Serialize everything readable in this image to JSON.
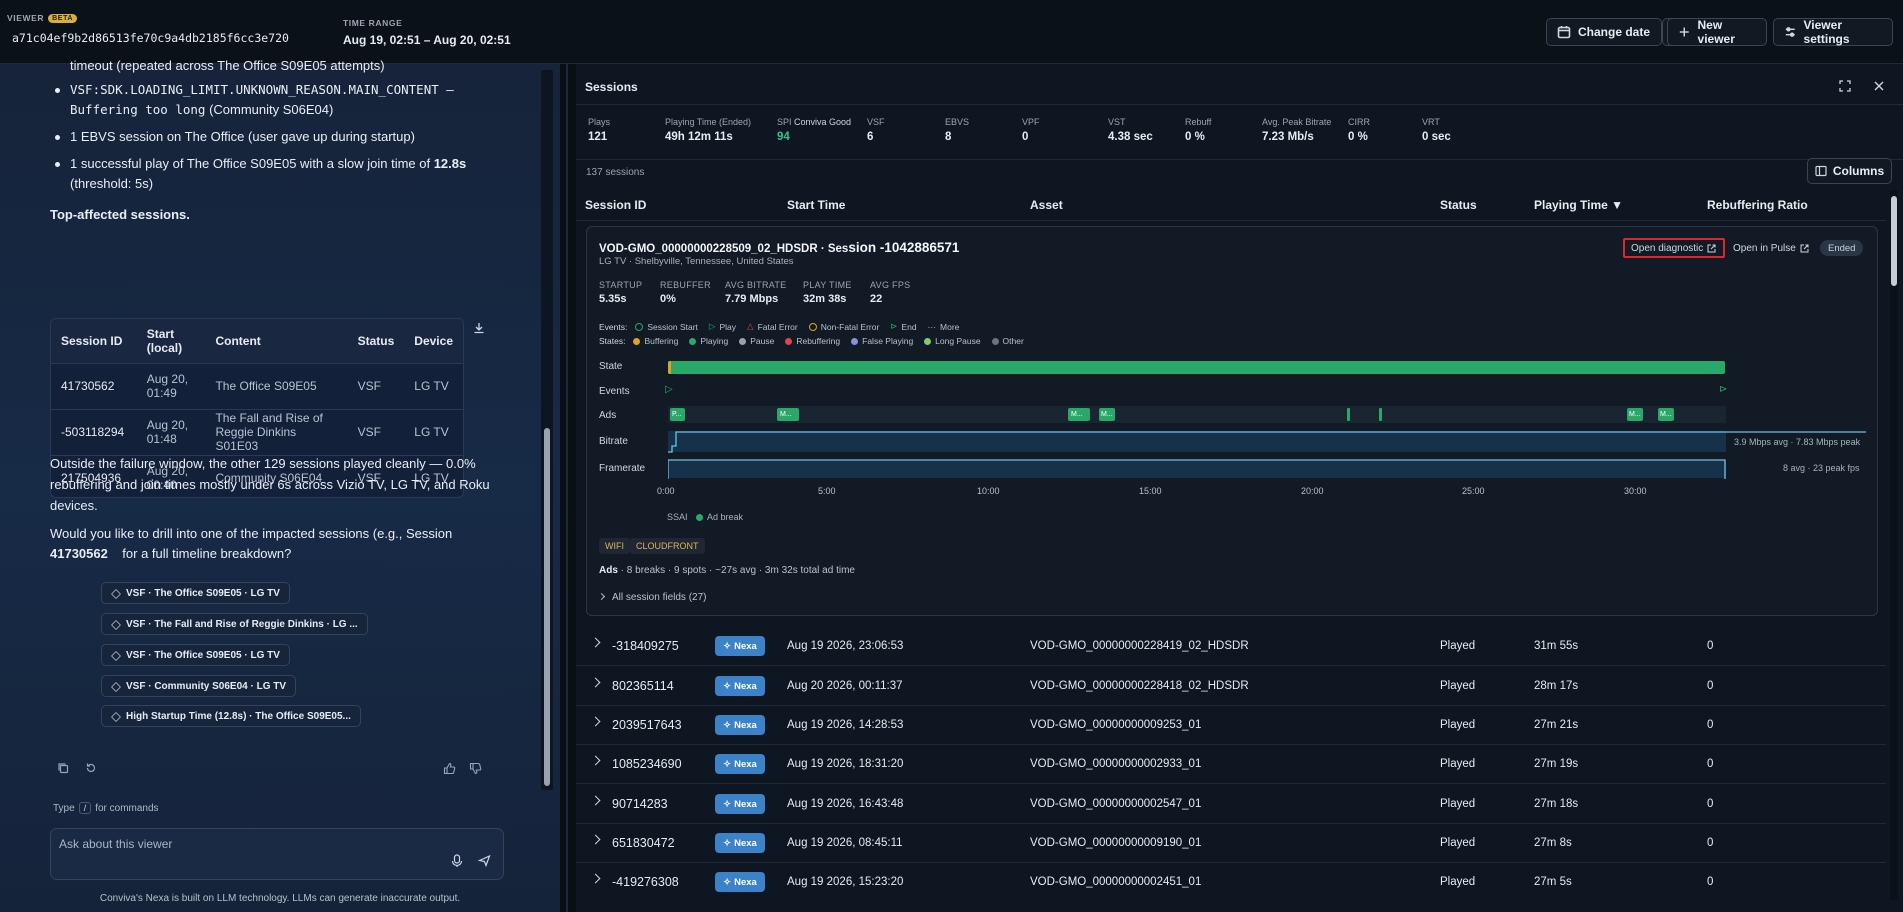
{
  "topbar": {
    "viewer_label": "VIEWER",
    "beta": "BETA",
    "viewer_id": "a71c04ef9b2d86513fe70c9a4db2185f6cc3e720",
    "time_range_label": "TIME RANGE",
    "time_range": "Aug 19, 02:51 – Aug 20, 02:51",
    "change_date": "Change date",
    "new_viewer": "New viewer",
    "viewer_settings": "Viewer settings"
  },
  "chat": {
    "line0": "timeout (repeated across The Office S09E05 attempts)",
    "b1_code": "VSF:SDK.LOADING_LIMIT.UNKNOWN_REASON.MAIN_CONTENT – Buffering too long",
    "b1_rest": " (Community S06E04)",
    "b2": "1 EBVS session on The Office (user gave up during startup)",
    "b3_pre": "1 successful play of The Office S09E05 with a slow join time of ",
    "b3_bold": "12.8s",
    "b3_post": "(threshold: 5s)",
    "heading": "Top-affected sessions.",
    "table_headers": [
      "Session ID",
      "Start (local)",
      "Content",
      "Status",
      "Device"
    ],
    "table_rows": [
      {
        "id": "41730562",
        "start": "Aug 20, 01:49",
        "content": "The Office S09E05",
        "status": "VSF",
        "device": "LG TV"
      },
      {
        "id": "-503118294",
        "start": "Aug 20, 01:48",
        "content": "The Fall and Rise of Reggie Dinkins S01E03",
        "status": "VSF",
        "device": "LG TV"
      },
      {
        "id": "217504936",
        "start": "Aug 20, 00:40",
        "content": "Community S06E04",
        "status": "VSF",
        "device": "LG TV"
      }
    ],
    "para1": "Outside the failure window, the other 129 sessions played cleanly — 0.0% rebuffering and join times mostly under 6s across Vizio TV, LG TV, and Roku devices.",
    "para2_pre": "Would you like to drill into one of the impacted sessions (e.g., Session",
    "para2_bold": "41730562",
    "para2_post": "for a full timeline breakdown?",
    "suggestions": [
      "VSF · The Office S09E05 · LG TV",
      "VSF · The Fall and Rise of Reggie Dinkins · LG ...",
      "VSF · The Office S09E05 · LG TV",
      "VSF · Community S06E04 · LG TV",
      "High Startup Time (12.8s) · The Office S09E05..."
    ],
    "cmd_pre": "Type",
    "cmd_key": "/",
    "cmd_post": "for commands",
    "input_placeholder": "Ask about this viewer",
    "disclaimer": "Conviva's Nexa is built on LLM technology. LLMs can generate inaccurate output."
  },
  "sessions": {
    "title": "Sessions",
    "metrics": [
      {
        "label": "Plays",
        "value": "121"
      },
      {
        "label": "Playing Time (Ended)",
        "value": "49h 12m 11s"
      },
      {
        "label": "SPI",
        "sub": "Conviva Good",
        "value": "94"
      },
      {
        "label": "VSF",
        "value": "6"
      },
      {
        "label": "EBVS",
        "value": "8"
      },
      {
        "label": "VPF",
        "value": "0"
      },
      {
        "label": "VST",
        "value": "4.38 sec"
      },
      {
        "label": "Rebuff",
        "value": "0 %"
      },
      {
        "label": "Avg. Peak Bitrate",
        "value": "7.23 Mb/s"
      },
      {
        "label": "CIRR",
        "value": "0 %"
      },
      {
        "label": "VRT",
        "value": "0 sec"
      }
    ],
    "count": "137 sessions",
    "columns_btn": "Columns",
    "headers": {
      "session_id": "Session ID",
      "start_time": "Start Time",
      "asset": "Asset",
      "status": "Status",
      "playing_time": "Playing Time ▼",
      "rebuffering": "Rebuffering Ratio"
    },
    "expanded": {
      "title_main": "VOD-GMO_00000000228509_02_HDSDR · Ses",
      "title_big": "sion -1042886571",
      "location": "LG TV · Shelbyville, Tennessee, United States",
      "open_diag": "Open diagnostic",
      "open_pulse": "Open in Pulse",
      "status": "Ended",
      "stats": [
        {
          "label": "STARTUP",
          "value": "5.35s"
        },
        {
          "label": "REBUFFER",
          "value": "0%"
        },
        {
          "label": "AVG BITRATE",
          "value": "7.79 Mbps"
        },
        {
          "label": "PLAY TIME",
          "value": "32m 38s"
        },
        {
          "label": "AVG FPS",
          "value": "22"
        }
      ],
      "events_label": "Events:",
      "events": [
        "Session Start",
        "Play",
        "Fatal Error",
        "Non-Fatal Error",
        "End",
        "More"
      ],
      "states_label": "States:",
      "states": [
        {
          "name": "Buffering",
          "color": "#e0a31f"
        },
        {
          "name": "Playing",
          "color": "#2aa86a"
        },
        {
          "name": "Pause",
          "color": "#9aa3ad"
        },
        {
          "name": "Rebuffering",
          "color": "#e0444b"
        },
        {
          "name": "False Playing",
          "color": "#8a8fe0"
        },
        {
          "name": "Long Pause",
          "color": "#7ecb72"
        },
        {
          "name": "Other",
          "color": "#6b7480"
        }
      ],
      "rows": {
        "state": "State",
        "events": "Events",
        "ads": "Ads",
        "bitrate": "Bitrate",
        "framerate": "Framerate"
      },
      "ad_labels": [
        "P...",
        "M...",
        "M...",
        "M...",
        "M...",
        "M..."
      ],
      "bitrate_note": "3.9 Mbps avg · 7.83 Mbps peak",
      "framerate_note": "8 avg · 23 peak fps",
      "ticks": [
        "0:00",
        "5:00",
        "10:00",
        "15:00",
        "20:00",
        "25:00",
        "30:00"
      ],
      "ssai": "SSAI",
      "ad_break": "Ad break",
      "tags": [
        "WIFI",
        "CLOUDFRONT"
      ],
      "ads_bold": "Ads",
      "ads_rest": " · 8 breaks · 9 spots · ~27s avg · 3m 32s total ad time",
      "fields": "All session fields (27)"
    },
    "nexa": "Nexa",
    "rows": [
      {
        "id": "-318409275",
        "start": "Aug 19 2026, 23:06:53",
        "asset": "VOD-GMO_00000000228419_02_HDSDR",
        "status": "Played",
        "time": "31m 55s",
        "rebuf": "0"
      },
      {
        "id": "802365114",
        "start": "Aug 20 2026, 00:11:37",
        "asset": "VOD-GMO_00000000228418_02_HDSDR",
        "status": "Played",
        "time": "28m 17s",
        "rebuf": "0"
      },
      {
        "id": "2039517643",
        "start": "Aug 19 2026, 14:28:53",
        "asset": "VOD-GMO_00000000009253_01",
        "status": "Played",
        "time": "27m 21s",
        "rebuf": "0"
      },
      {
        "id": "1085234690",
        "start": "Aug 19 2026, 18:31:20",
        "asset": "VOD-GMO_00000000002933_01",
        "status": "Played",
        "time": "27m 19s",
        "rebuf": "0"
      },
      {
        "id": "90714283",
        "start": "Aug 19 2026, 16:43:48",
        "asset": "VOD-GMO_00000000002547_01",
        "status": "Played",
        "time": "27m 18s",
        "rebuf": "0"
      },
      {
        "id": "651830472",
        "start": "Aug 19 2026, 08:45:11",
        "asset": "VOD-GMO_00000000009190_01",
        "status": "Played",
        "time": "27m 8s",
        "rebuf": "0"
      },
      {
        "id": "-419276308",
        "start": "Aug 19 2026, 15:23:20",
        "asset": "VOD-GMO_00000000002451_01",
        "status": "Played",
        "time": "27m 5s",
        "rebuf": "0"
      }
    ]
  },
  "colors": {
    "accent": "#3b82c8",
    "playing": "#2aa86a",
    "highlight": "#e0262d",
    "spi_good": "#2fc38a"
  }
}
